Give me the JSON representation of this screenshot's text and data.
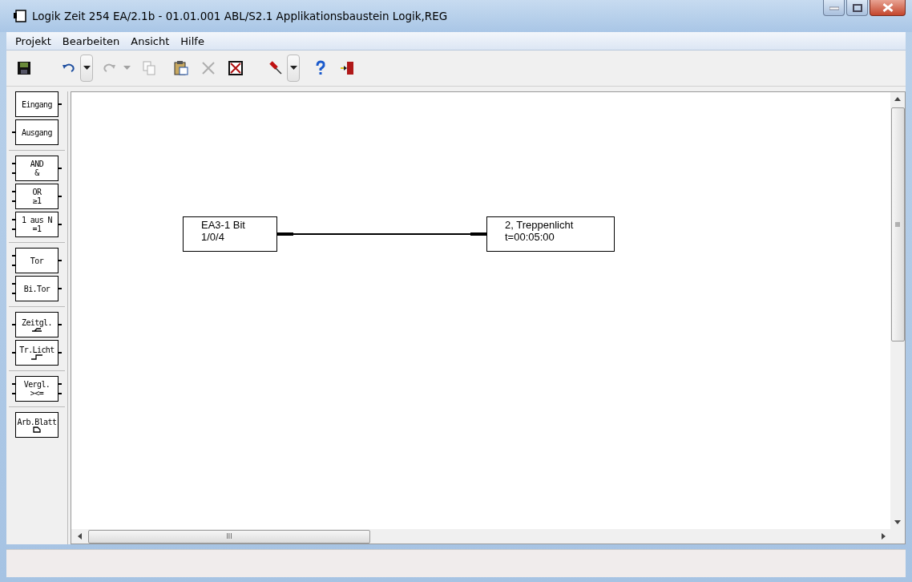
{
  "window": {
    "title": "Logik Zeit 254 EA/2.1b - 01.01.001 ABL/S2.1 Applikationsbaustein Logik,REG"
  },
  "menu": [
    "Projekt",
    "Bearbeiten",
    "Ansicht",
    "Hilfe"
  ],
  "toolbar": [
    {
      "kind": "save",
      "disabled": false
    },
    {
      "kind": "undo",
      "disabled": false
    },
    {
      "kind": "dropdown",
      "disabled": false
    },
    {
      "kind": "redo",
      "disabled": true
    },
    {
      "kind": "dropdown",
      "disabled": true
    },
    {
      "kind": "copy",
      "disabled": true
    },
    {
      "kind": "paste",
      "disabled": false
    },
    {
      "kind": "delete",
      "disabled": true
    },
    {
      "kind": "delete-box",
      "disabled": false
    },
    {
      "kind": "pin",
      "disabled": false
    },
    {
      "kind": "dropdown",
      "disabled": false
    },
    {
      "kind": "help",
      "disabled": false
    },
    {
      "kind": "exit",
      "disabled": false
    }
  ],
  "palette": [
    [
      {
        "kind": "source",
        "label": "Eingang"
      },
      {
        "kind": "sink",
        "label": "Ausgang"
      }
    ],
    [
      {
        "kind": "gate2",
        "label": "AND",
        "sublabel": "&"
      },
      {
        "kind": "gate2",
        "label": "OR",
        "sublabel": "≥1"
      },
      {
        "kind": "gate2",
        "label": "1 aus N",
        "sublabel": "=1"
      }
    ],
    [
      {
        "kind": "gate2",
        "label": "Tor"
      },
      {
        "kind": "gate2",
        "label": "Bi.Tor"
      }
    ],
    [
      {
        "kind": "delay",
        "label": "Zeitgl."
      },
      {
        "kind": "step",
        "label": "Tr.Licht"
      }
    ],
    [
      {
        "kind": "compare",
        "label": "Vergl.",
        "sublabel": "><="
      }
    ],
    [
      {
        "kind": "sheet",
        "label": "Arb.Blatt"
      }
    ]
  ],
  "diagram": {
    "nodes": [
      {
        "lines": [
          "EA3-1 Bit",
          "1/0/4"
        ]
      },
      {
        "lines": [
          "2, Treppenlicht",
          "t=00:05:00"
        ]
      }
    ]
  },
  "scrollbar_label": "III"
}
